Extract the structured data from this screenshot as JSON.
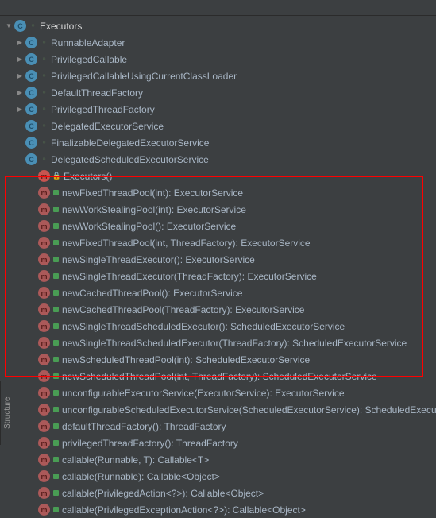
{
  "toolbar": {},
  "root": {
    "label": "Executors"
  },
  "classes": [
    {
      "label": "RunnableAdapter",
      "expandable": true
    },
    {
      "label": "PrivilegedCallable",
      "expandable": true
    },
    {
      "label": "PrivilegedCallableUsingCurrentClassLoader",
      "expandable": true
    },
    {
      "label": "DefaultThreadFactory",
      "expandable": true
    },
    {
      "label": "PrivilegedThreadFactory",
      "expandable": true
    },
    {
      "label": "DelegatedExecutorService",
      "expandable": false
    },
    {
      "label": "FinalizableDelegatedExecutorService",
      "expandable": false
    },
    {
      "label": "DelegatedScheduledExecutorService",
      "expandable": false
    }
  ],
  "constructor": {
    "label": "Executors()"
  },
  "methods_boxed": [
    {
      "label": "newFixedThreadPool(int): ExecutorService"
    },
    {
      "label": "newWorkStealingPool(int): ExecutorService"
    },
    {
      "label": "newWorkStealingPool(): ExecutorService"
    },
    {
      "label": "newFixedThreadPool(int, ThreadFactory): ExecutorService"
    },
    {
      "label": "newSingleThreadExecutor(): ExecutorService"
    },
    {
      "label": "newSingleThreadExecutor(ThreadFactory): ExecutorService"
    },
    {
      "label": "newCachedThreadPool(): ExecutorService"
    },
    {
      "label": "newCachedThreadPool(ThreadFactory): ExecutorService"
    },
    {
      "label": "newSingleThreadScheduledExecutor(): ScheduledExecutorService"
    },
    {
      "label": "newSingleThreadScheduledExecutor(ThreadFactory): ScheduledExecutorService"
    },
    {
      "label": "newScheduledThreadPool(int): ScheduledExecutorService"
    },
    {
      "label": "newScheduledThreadPool(int, ThreadFactory): ScheduledExecutorService"
    }
  ],
  "methods_rest": [
    {
      "label": "unconfigurableExecutorService(ExecutorService): ExecutorService"
    },
    {
      "label": "unconfigurableScheduledExecutorService(ScheduledExecutorService): ScheduledExecutorService"
    },
    {
      "label": "defaultThreadFactory(): ThreadFactory"
    },
    {
      "label": "privilegedThreadFactory(): ThreadFactory"
    },
    {
      "label": "callable(Runnable, T): Callable<T>"
    },
    {
      "label": "callable(Runnable): Callable<Object>"
    },
    {
      "label": "callable(PrivilegedAction<?>): Callable<Object>"
    },
    {
      "label": "callable(PrivilegedExceptionAction<?>): Callable<Object>"
    }
  ],
  "sidetab": {
    "label": "Structure"
  }
}
